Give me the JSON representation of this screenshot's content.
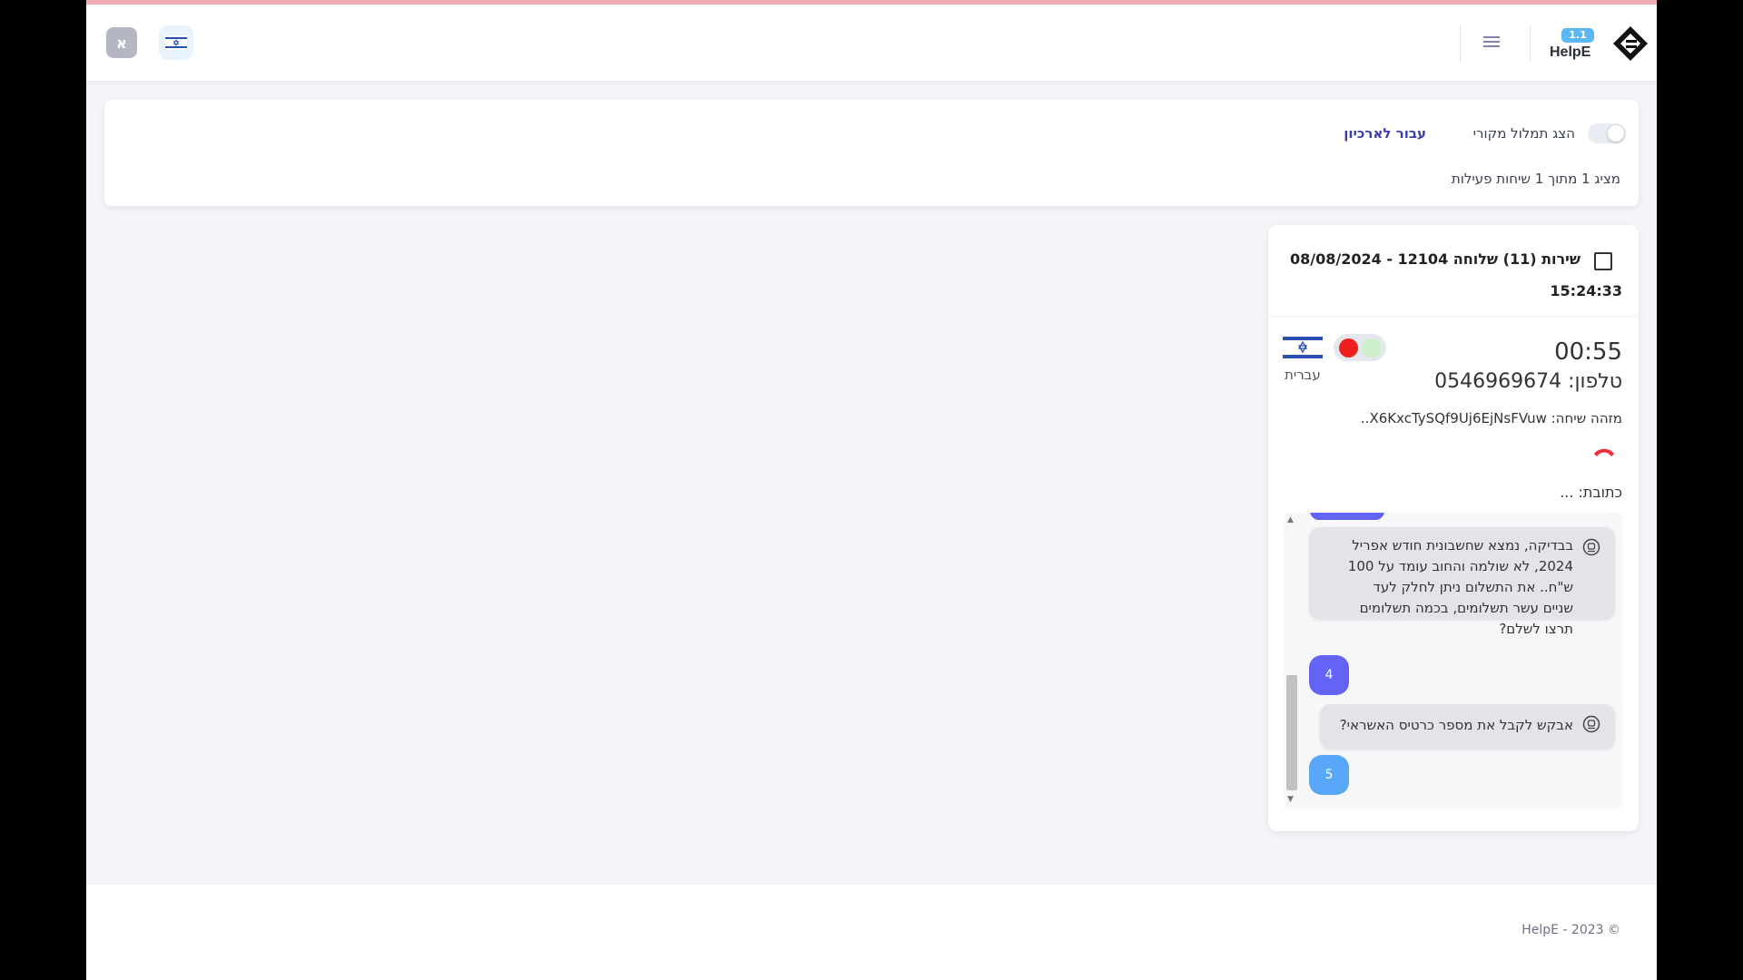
{
  "header": {
    "avatar_letter": "א",
    "logo_badge": "1.1",
    "logo_text": "HelpE"
  },
  "filters": {
    "show_original_transcript_label": "הצג תמלול מקורי",
    "show_original_transcript_enabled": false,
    "archive_link": "עבור לארכיון",
    "showing_count": "מציג 1 מתוך 1 שיחות פעילות"
  },
  "call_card": {
    "title": "שירות (11) שלוחה 12104 - 08/08/2024",
    "time": "15:24:33",
    "duration": "00:55",
    "phone": "טלפון: 0546969674",
    "language": "עברית",
    "call_id": "מזהה שיחה: X6KxcTySQf9Uj6EjNsFVuw..",
    "address": "כתובת: ...",
    "messages": [
      {
        "text": "בבדיקה, נמצא שחשבונית חודש אפריל 2024, לא שולמה והחוב עומד על 100 ש\"ח.. את התשלום ניתן לחלק לעד שניים עשר תשלומים, בכמה תשלומים תרצו לשלם?"
      },
      {
        "user_reply": "4"
      },
      {
        "text": "אבקש לקבל את מספר כרטיס האשראי?"
      },
      {
        "user_reply": "5"
      }
    ]
  },
  "footer": {
    "copyright": "HelpE - 2023 ©"
  }
}
